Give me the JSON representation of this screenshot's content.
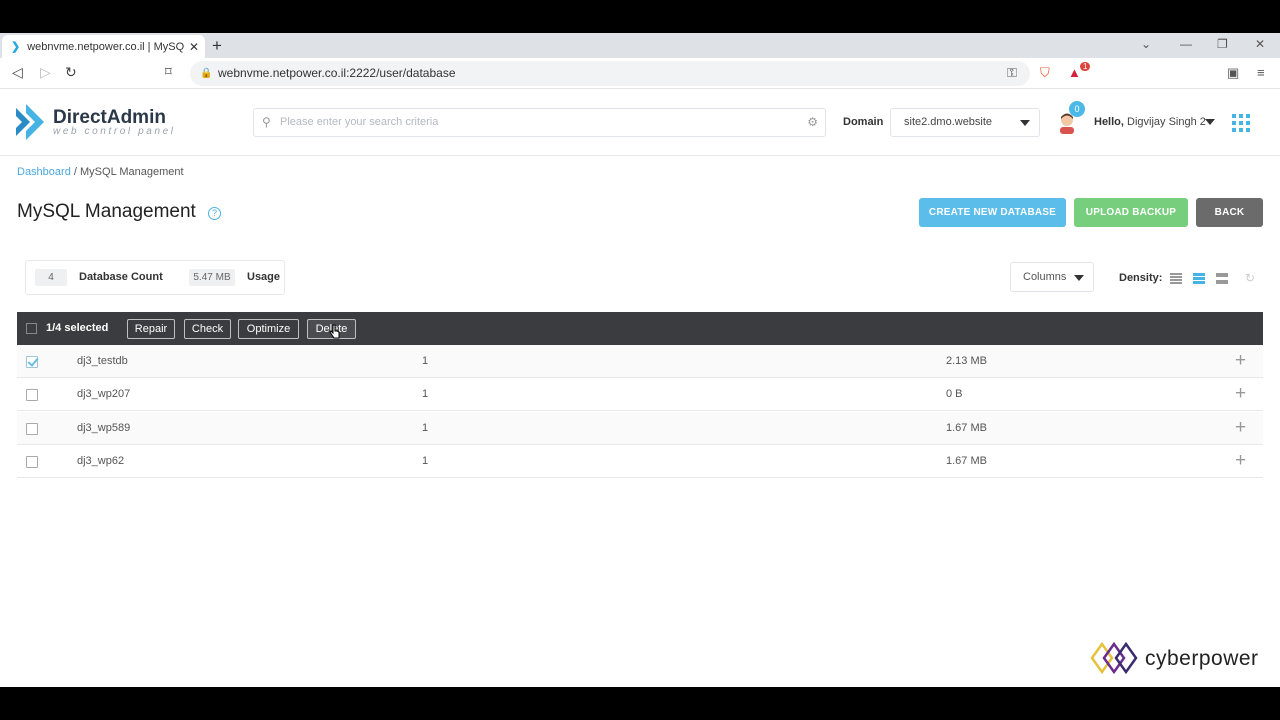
{
  "browser": {
    "tab_title": "webnvme.netpower.co.il | MySQL",
    "url": "webnvme.netpower.co.il:2222/user/database",
    "ext_badge": "1"
  },
  "header": {
    "logo_title": "DirectAdmin",
    "logo_subtitle": "web control panel",
    "search_placeholder": "Please enter your search criteria",
    "domain_label": "Domain",
    "domain_value": "site2.dmo.website",
    "notification_count": "0",
    "hello_label": "Hello,",
    "user_name": "Digvijay Singh 2"
  },
  "breadcrumb": {
    "home": "Dashboard",
    "separator": "/",
    "current": "MySQL Management"
  },
  "page": {
    "title": "MySQL Management",
    "help": "?",
    "buttons": {
      "create": "CREATE NEW DATABASE",
      "upload": "UPLOAD BACKUP",
      "back": "BACK"
    }
  },
  "stats": {
    "db_count": "4",
    "db_count_label": "Database Count",
    "usage": "5.47 MB",
    "usage_label": "Usage"
  },
  "toolbar": {
    "columns_label": "Columns",
    "density_label": "Density:"
  },
  "bulk": {
    "selected_text": "1/4 selected",
    "actions": [
      "Repair",
      "Check",
      "Optimize",
      "Delete"
    ]
  },
  "rows": [
    {
      "name": "dj3_testdb",
      "users": "1",
      "size": "2.13 MB",
      "checked": true
    },
    {
      "name": "dj3_wp207",
      "users": "1",
      "size": "0 B",
      "checked": false
    },
    {
      "name": "dj3_wp589",
      "users": "1",
      "size": "1.67 MB",
      "checked": false
    },
    {
      "name": "dj3_wp62",
      "users": "1",
      "size": "1.67 MB",
      "checked": false
    }
  ],
  "watermark": "cyberpower",
  "colors": {
    "accent_blue": "#5bbde9",
    "success_green": "#77cf7e",
    "neutral_grey": "#6b6b6b",
    "bulk_bar": "#3a3c3f"
  }
}
